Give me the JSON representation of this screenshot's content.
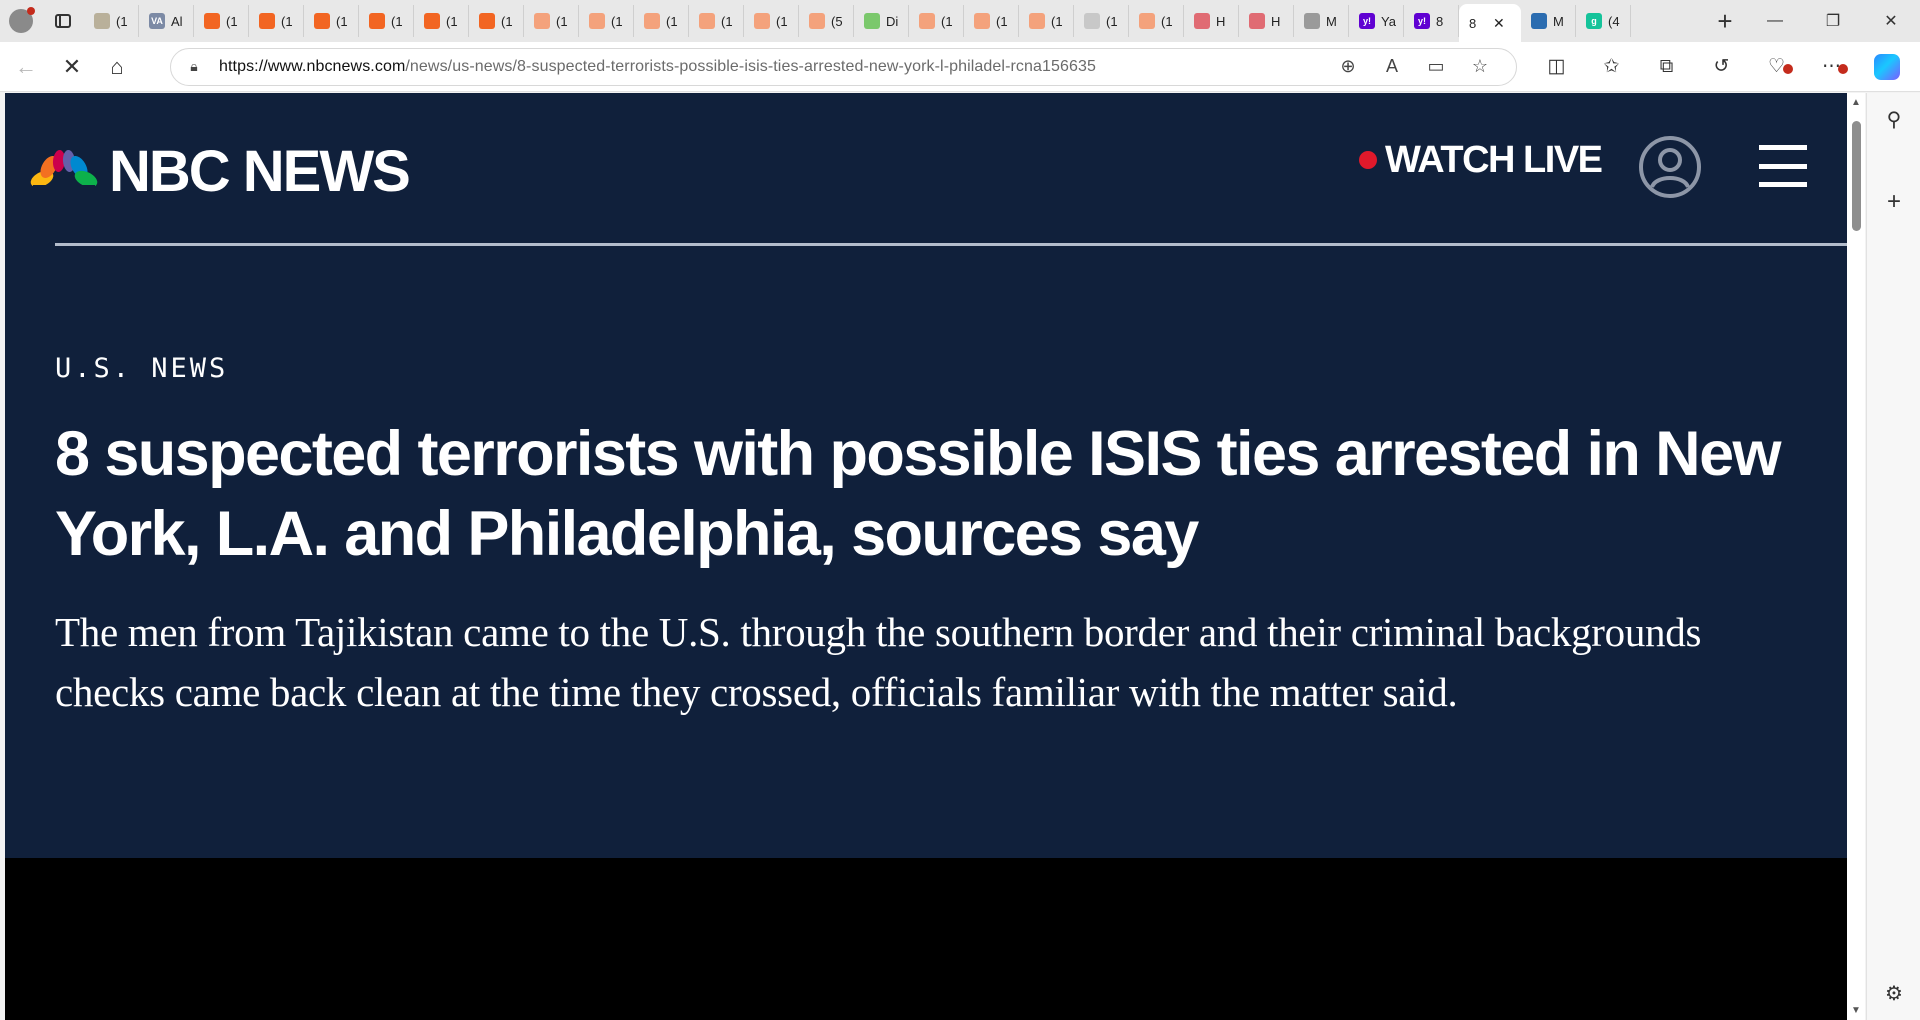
{
  "browser": {
    "tabs": [
      {
        "title": "(1",
        "favicon_color": "#b9b09a"
      },
      {
        "title": "Al",
        "favicon_color": "#7c8aa5",
        "favicon_text": "VA"
      },
      {
        "title": "(1",
        "favicon_color": "#f26522"
      },
      {
        "title": "(1",
        "favicon_color": "#f26522"
      },
      {
        "title": "(1",
        "favicon_color": "#f26522"
      },
      {
        "title": "(1",
        "favicon_color": "#f26522"
      },
      {
        "title": "(1",
        "favicon_color": "#f26522"
      },
      {
        "title": "(1",
        "favicon_color": "#f26522"
      },
      {
        "title": "(1",
        "favicon_color": "#f4a27c"
      },
      {
        "title": "(1",
        "favicon_color": "#f4a27c"
      },
      {
        "title": "(1",
        "favicon_color": "#f4a27c"
      },
      {
        "title": "(1",
        "favicon_color": "#f4a27c"
      },
      {
        "title": "(1",
        "favicon_color": "#f4a27c"
      },
      {
        "title": "(5",
        "favicon_color": "#f4a27c"
      },
      {
        "title": "Di",
        "favicon_color": "#7bc86c"
      },
      {
        "title": "(1",
        "favicon_color": "#f4a27c"
      },
      {
        "title": "(1",
        "favicon_color": "#f4a27c"
      },
      {
        "title": "(1",
        "favicon_color": "#f4a27c"
      },
      {
        "title": "(1",
        "favicon_color": "#c8c8c8"
      },
      {
        "title": "(1",
        "favicon_color": "#f4a27c"
      },
      {
        "title": "H",
        "favicon_color": "#e06b73"
      },
      {
        "title": "H",
        "favicon_color": "#e06b73"
      },
      {
        "title": "M",
        "favicon_color": "#9a9a9a"
      },
      {
        "title": "Ya",
        "favicon_color": "#6001d2",
        "favicon_text": "y!"
      },
      {
        "title": "8",
        "favicon_color": "#6001d2",
        "favicon_text": "y!"
      },
      {
        "title": "8",
        "favicon_color": "#ffffff",
        "active": true
      },
      {
        "title": "M",
        "favicon_color": "#2b6cb0"
      },
      {
        "title": "(4",
        "favicon_color": "#15c39a",
        "favicon_text": "g"
      }
    ],
    "active_tab_close": "✕",
    "new_tab": "+",
    "window_controls": {
      "minimize": "—",
      "restore": "❐",
      "close": "✕"
    },
    "url_host": "https://www.nbcnews.com",
    "url_path": "/news/us-news/8-suspected-terrorists-possible-isis-ties-arrested-new-york-l-philadel-rcna156635",
    "icons": [
      "back-icon",
      "stop-icon",
      "home-icon",
      "lock-icon",
      "zoom-icon",
      "read-aloud-icon",
      "immersive-reader-icon",
      "favorite-star-icon",
      "split-screen-icon",
      "favorites-icon",
      "collections-icon",
      "history-icon",
      "performance-icon",
      "more-icon",
      "copilot-icon",
      "sidebar-search-icon",
      "sidebar-add-icon",
      "sidebar-settings-icon"
    ]
  },
  "site": {
    "brand": "NBC NEWS",
    "watch_live": "WATCH LIVE",
    "live_dot_color": "#e0192b",
    "background_color": "#10203b"
  },
  "article": {
    "section": "U.S. NEWS",
    "headline": "8 suspected terrorists with possible ISIS ties arrested in New York, L.A. and Philadelphia, sources say",
    "dek": "The men from Tajikistan came to the U.S. through the southern border and their criminal backgrounds checks came back clean at the time they crossed, officials familiar with the matter said."
  }
}
